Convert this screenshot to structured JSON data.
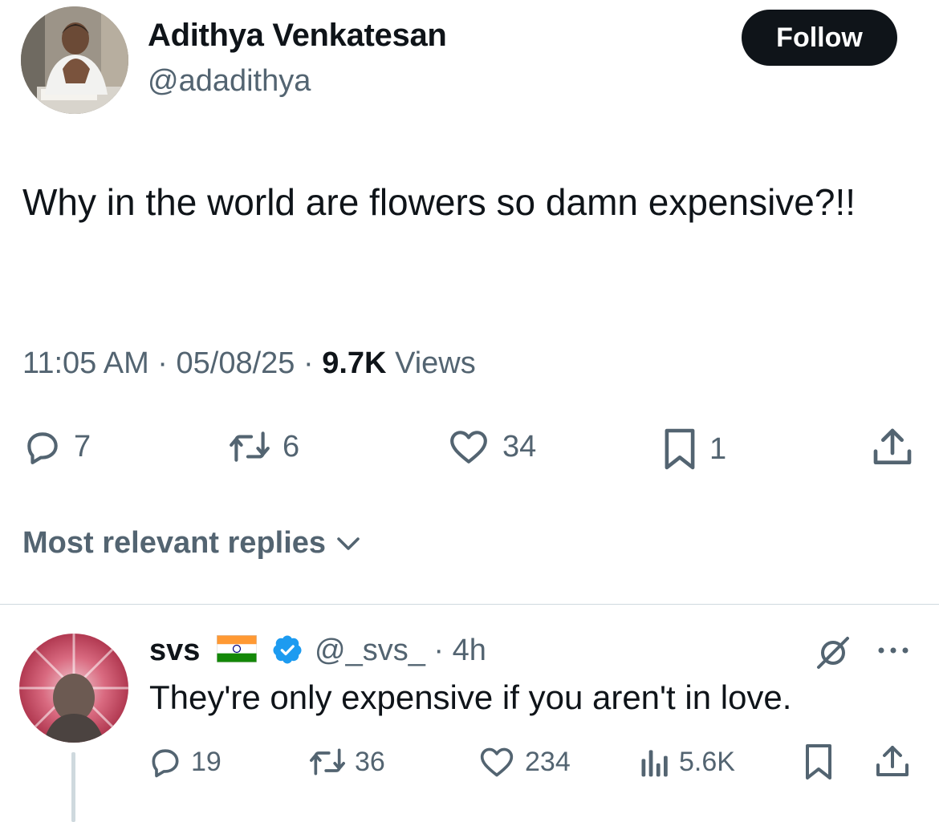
{
  "tweet": {
    "author_name": "Adithya Venkatesan",
    "author_handle": "@adadithya",
    "follow_label": "Follow",
    "text": "Why in the world are flowers so damn expensive?!!",
    "time": "11:05 AM",
    "date": "05/08/25",
    "views_count": "9.7K",
    "views_label": "Views",
    "separator": "·",
    "actions": {
      "replies": "7",
      "reposts": "6",
      "likes": "34",
      "bookmarks": "1"
    }
  },
  "replies_sort": {
    "label": "Most relevant replies"
  },
  "reply": {
    "author_name": "svs",
    "flag": "🇮🇳",
    "author_handle": "@_svs_",
    "age": "· 4h",
    "text": "They're only expensive if you aren't in love.",
    "actions": {
      "replies": "19",
      "reposts": "36",
      "likes": "234",
      "views": "5.6K"
    }
  },
  "colors": {
    "text_primary": "#0f1419",
    "text_secondary": "#536471",
    "verified_blue": "#1d9bf0",
    "divider": "#cfd9de"
  },
  "icons": [
    "reply-icon",
    "repost-icon",
    "like-icon",
    "bookmark-icon",
    "share-icon",
    "views-icon",
    "chevron-down-icon",
    "verified-icon",
    "grok-icon",
    "more-icon"
  ]
}
